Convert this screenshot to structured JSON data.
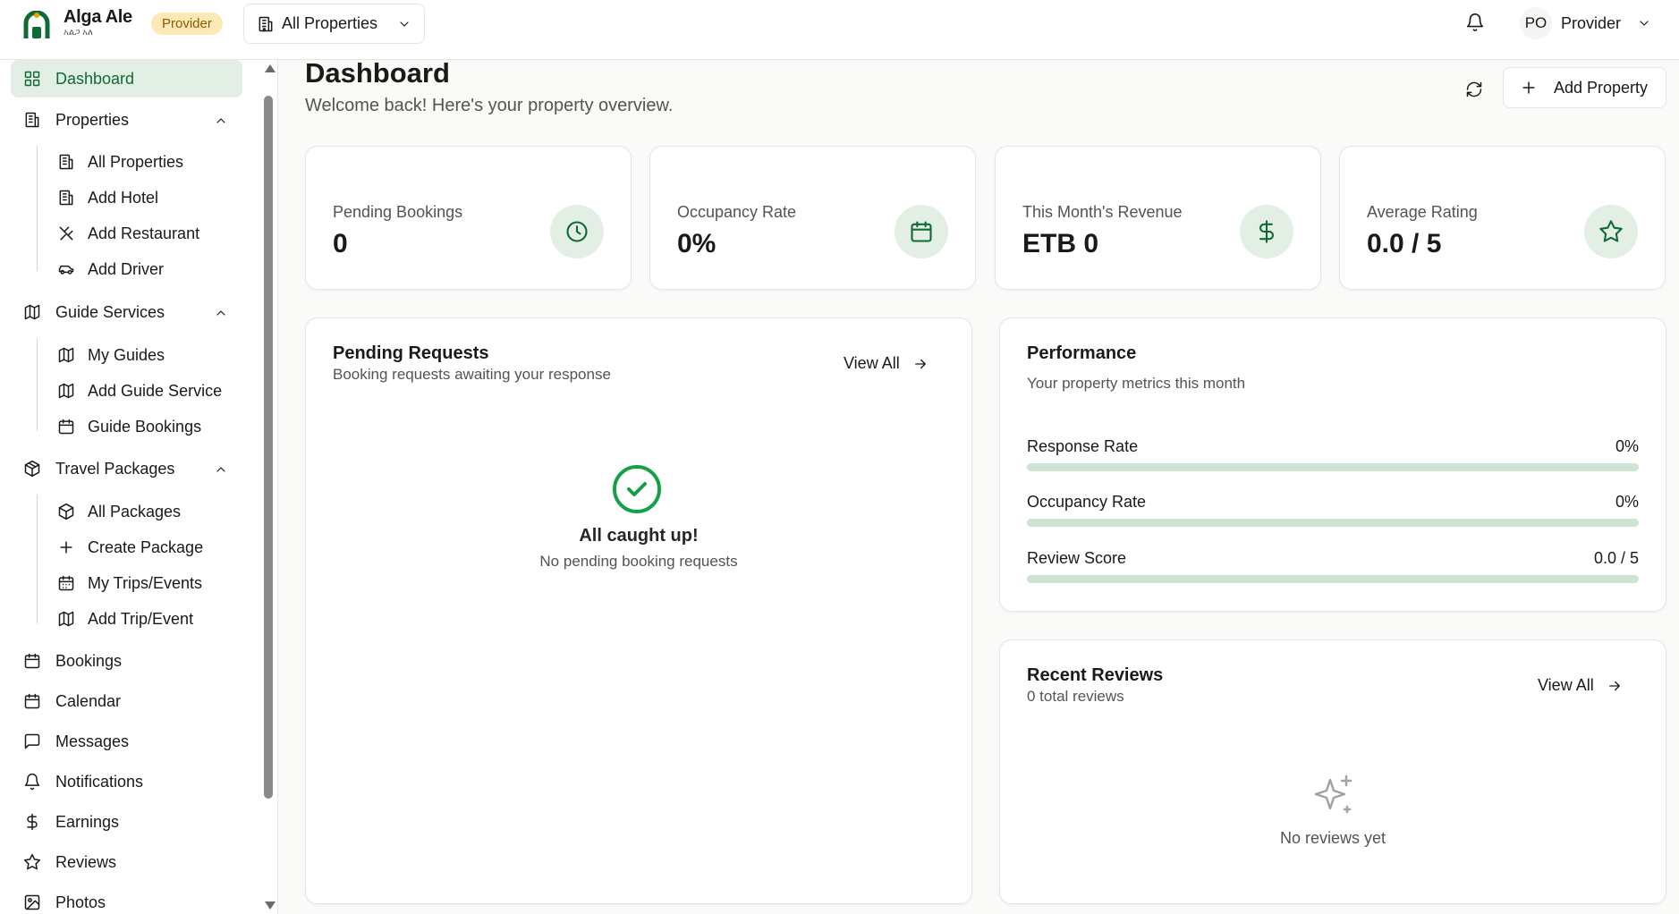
{
  "brand": {
    "name": "Alga Ale",
    "subtitle": "አልጋ አለ",
    "role_badge": "Provider",
    "accent": "#0f6b36",
    "badge_color": "#fde9b6"
  },
  "property_selector": {
    "value": "All Properties"
  },
  "user": {
    "initials": "PO",
    "name": "Provider"
  },
  "sidebar": {
    "dashboard": {
      "label": "Dashboard",
      "icon": "layout-grid-icon"
    },
    "properties": {
      "label": "Properties",
      "items": [
        "All Properties",
        "Add Hotel",
        "Add Restaurant",
        "Add Driver"
      ]
    },
    "guide_services": {
      "label": "Guide Services",
      "items": [
        "My Guides",
        "Add Guide Service",
        "Guide Bookings"
      ]
    },
    "travel_packages": {
      "label": "Travel Packages",
      "items": [
        "All Packages",
        "Create Package",
        "My Trips/Events",
        "Add Trip/Event"
      ]
    },
    "bookings": "Bookings",
    "calendar": "Calendar",
    "messages": "Messages",
    "notifications": "Notifications",
    "earnings": "Earnings",
    "reviews": "Reviews",
    "photos": "Photos"
  },
  "header": {
    "title": "Dashboard",
    "subtitle": "Welcome back! Here's your property overview.",
    "add_property": "Add Property"
  },
  "stats": [
    {
      "label": "Pending Bookings",
      "value": "0",
      "icon": "clock-icon"
    },
    {
      "label": "Occupancy Rate",
      "value": "0%",
      "icon": "calendar-icon"
    },
    {
      "label": "This Month's Revenue",
      "value": "ETB 0",
      "icon": "dollar-icon"
    },
    {
      "label": "Average Rating",
      "value": "0.0 / 5",
      "icon": "star-icon"
    }
  ],
  "pending_requests": {
    "title": "Pending Requests",
    "subtitle": "Booking requests awaiting your response",
    "view_all": "View All",
    "empty_title": "All caught up!",
    "empty_subtitle": "No pending booking requests"
  },
  "performance": {
    "title": "Performance",
    "subtitle": "Your property metrics this month",
    "metrics": [
      {
        "label": "Response Rate",
        "value": "0%",
        "fraction": 0
      },
      {
        "label": "Occupancy Rate",
        "value": "0%",
        "fraction": 0
      },
      {
        "label": "Review Score",
        "value": "0.0 / 5",
        "fraction": 0
      }
    ]
  },
  "recent_reviews": {
    "title": "Recent Reviews",
    "subtitle": "0 total reviews",
    "view_all": "View All",
    "empty": "No reviews yet"
  }
}
